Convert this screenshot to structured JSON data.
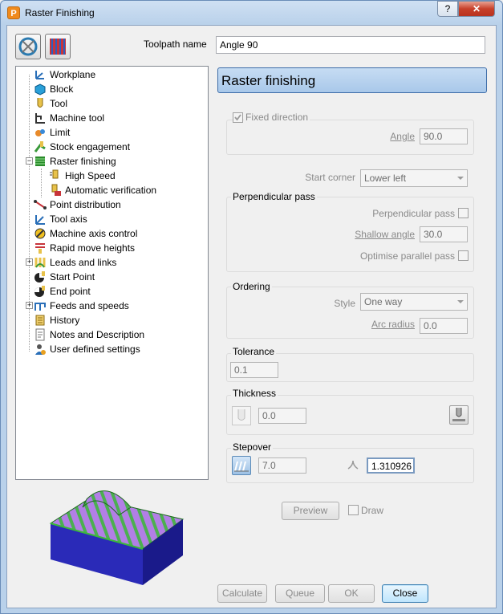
{
  "window": {
    "title": "Raster Finishing",
    "app_icon": "P",
    "help_label": "?",
    "close_label": "✕"
  },
  "toolbar": {
    "icon1": "toolpath-strategy-icon",
    "icon2": "raster-pattern-icon"
  },
  "toolpath_name": {
    "label": "Toolpath name",
    "value": "Angle 90"
  },
  "tree": {
    "items": [
      {
        "label": "Workplane",
        "icon": "workplane-icon"
      },
      {
        "label": "Block",
        "icon": "block-icon"
      },
      {
        "label": "Tool",
        "icon": "tool-icon"
      },
      {
        "label": "Machine tool",
        "icon": "machine-tool-icon"
      },
      {
        "label": "Limit",
        "icon": "limit-icon"
      },
      {
        "label": "Stock engagement",
        "icon": "stock-engagement-icon"
      },
      {
        "label": "Raster finishing",
        "icon": "raster-finishing-icon"
      },
      {
        "label": "High Speed",
        "icon": "high-speed-icon"
      },
      {
        "label": "Automatic verification",
        "icon": "automatic-verification-icon"
      },
      {
        "label": "Point distribution",
        "icon": "point-distribution-icon"
      },
      {
        "label": "Tool axis",
        "icon": "tool-axis-icon"
      },
      {
        "label": "Machine axis control",
        "icon": "machine-axis-control-icon"
      },
      {
        "label": "Rapid move heights",
        "icon": "rapid-move-heights-icon"
      },
      {
        "label": "Leads and links",
        "icon": "leads-links-icon"
      },
      {
        "label": "Start Point",
        "icon": "start-point-icon"
      },
      {
        "label": "End point",
        "icon": "end-point-icon"
      },
      {
        "label": "Feeds and speeds",
        "icon": "feeds-speeds-icon"
      },
      {
        "label": "History",
        "icon": "history-icon"
      },
      {
        "label": "Notes and Description",
        "icon": "notes-icon"
      },
      {
        "label": "User defined settings",
        "icon": "user-settings-icon"
      }
    ]
  },
  "panel": {
    "title": "Raster finishing"
  },
  "fixed_direction": {
    "label": "Fixed direction",
    "checked": true,
    "angle_label": "Angle",
    "angle_value": "90.0"
  },
  "start_corner": {
    "label": "Start corner",
    "value": "Lower left"
  },
  "perpendicular": {
    "title": "Perpendicular pass",
    "perp_label": "Perpendicular pass",
    "shallow_label": "Shallow angle",
    "shallow_value": "30.0",
    "optimise_label": "Optimise parallel pass"
  },
  "ordering": {
    "title": "Ordering",
    "style_label": "Style",
    "style_value": "One way",
    "arc_label": "Arc radius",
    "arc_value": "0.0"
  },
  "tolerance": {
    "title": "Tolerance",
    "value": "0.1"
  },
  "thickness": {
    "title": "Thickness",
    "value": "0.0",
    "icon_left": "thickness-tool-icon",
    "icon_right": "thickness-options-icon"
  },
  "stepover": {
    "title": "Stepover",
    "value": "7.0",
    "cusp_value": "1.310926",
    "icon_left": "stepover-icon",
    "icon_cusp": "cusp-icon"
  },
  "preview": {
    "label": "Preview",
    "draw_label": "Draw"
  },
  "footer": {
    "calculate": "Calculate",
    "queue": "Queue",
    "ok": "OK",
    "close": "Close"
  },
  "colors": {
    "accent": "#3e6da8",
    "header_bg": "#b4d0ee",
    "model_purple": "#b27fe6",
    "model_green": "#4caf50",
    "model_blue": "#2a2ab8"
  }
}
